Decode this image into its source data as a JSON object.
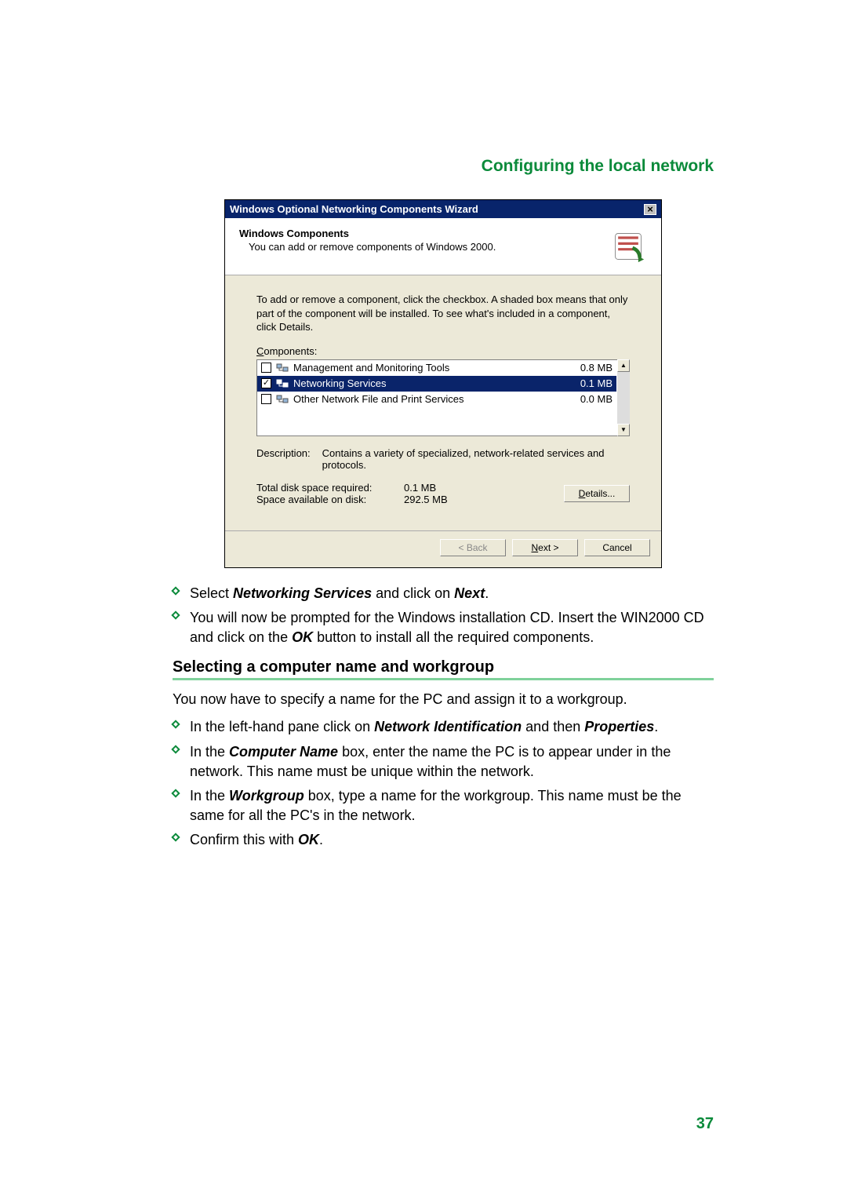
{
  "header": {
    "title": "Configuring the local network"
  },
  "dialog": {
    "title": "Windows Optional Networking Components Wizard",
    "heading": "Windows Components",
    "subheading": "You can add or remove components of Windows 2000.",
    "hint": "To add or remove a component, click the checkbox.  A shaded box means that only part of the component will be installed.  To see what's included in a component, click Details.",
    "components_label_prefix": "C",
    "components_label_rest": "omponents:",
    "items": [
      {
        "name": "Management and Monitoring Tools",
        "size": "0.8 MB",
        "checked": false,
        "selected": false
      },
      {
        "name": "Networking Services",
        "size": "0.1 MB",
        "checked": true,
        "selected": true
      },
      {
        "name": "Other Network File and Print Services",
        "size": "0.0 MB",
        "checked": false,
        "selected": false
      }
    ],
    "description_label": "Description:",
    "description_text": "Contains a variety of specialized, network-related services and protocols.",
    "total_label": "Total disk space required:",
    "total_value": "0.1 MB",
    "avail_label": "Space available on disk:",
    "avail_value": "292.5 MB",
    "details_btn_prefix": "D",
    "details_btn_rest": "etails...",
    "back_btn": "< Back",
    "next_btn_prefix": "N",
    "next_btn_rest": "ext >",
    "cancel_btn": "Cancel"
  },
  "bul1": {
    "a_pre": "Select ",
    "a_b": "Networking Services",
    "a_mid": " and click on ",
    "a_b2": "Next",
    "a_end": ".",
    "b_pre": "You will now be prompted for the Windows installation CD. Insert the WIN2000 CD and click on the ",
    "b_b": "OK",
    "b_end": " button to install all the required components."
  },
  "section2": {
    "title": "Selecting a computer name and workgroup"
  },
  "para2": "You now have to specify a name for the PC and assign it to a workgroup.",
  "bul2": {
    "a_pre": "In the left-hand pane click on ",
    "a_b1": "Network Identification",
    "a_mid": " and then ",
    "a_b2": "Properties",
    "a_end": ".",
    "b_pre": "In the ",
    "b_b": "Computer Name",
    "b_end": " box, enter the name the PC is to appear under in the network. This name must be unique within the network.",
    "c_pre": "In the ",
    "c_b": "Workgroup",
    "c_end": " box, type a name for the workgroup. This name must be the same for all the PC's in the network.",
    "d_pre": "Confirm this with ",
    "d_b": "OK",
    "d_end": "."
  },
  "page_number": "37"
}
